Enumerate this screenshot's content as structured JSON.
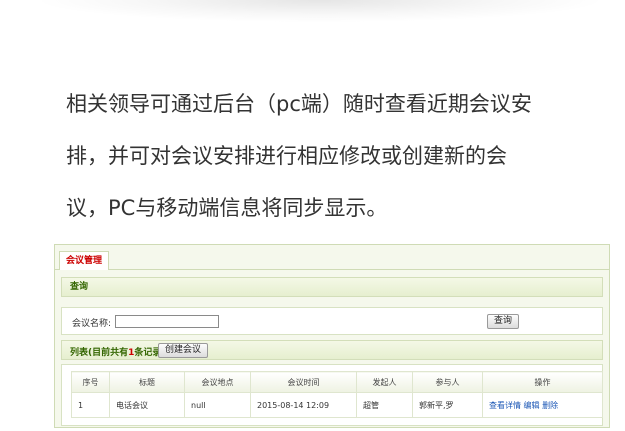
{
  "intro": {
    "line1": "相关领导可通过后台（pc端）随时查看近期会议安",
    "line2": "排，并可对会议安排进行相应修改或创建新的会",
    "line3": "议，PC与移动端信息将同步显示。"
  },
  "panel": {
    "tab_label": "会议管理",
    "search_section_title": "查询",
    "search": {
      "label": "会议名称:",
      "value": "",
      "placeholder": "",
      "button_label": "查询"
    },
    "list": {
      "title_prefix": "列表(目前共有",
      "count": "1",
      "title_suffix": "条记录)",
      "create_button_label": "创建会议"
    },
    "table": {
      "headers": [
        "序号",
        "标题",
        "会议地点",
        "会议时间",
        "发起人",
        "参与人",
        "操作"
      ],
      "rows": [
        {
          "index": "1",
          "title": "电话会议",
          "location": "null",
          "time": "2015-08-14 12:09",
          "initiator": "超管",
          "participants": "郭新平,罗",
          "action_view": "查看详情",
          "action_edit": "编辑",
          "action_delete": "删除"
        }
      ]
    }
  },
  "colors": {
    "tab_text": "#cc0000",
    "section_title": "#336600",
    "link": "#1a56b5",
    "panel_border": "#cfdbb5"
  }
}
